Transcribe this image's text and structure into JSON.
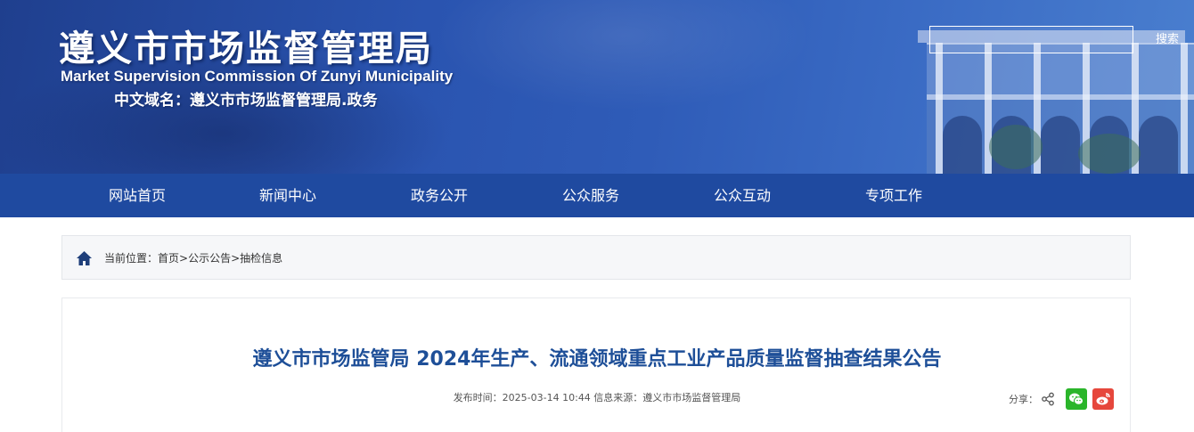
{
  "header": {
    "title": "遵义市市场监督管理局",
    "title_en": "Market Supervision Commission Of Zunyi Municipality",
    "domain_line": "中文域名：遵义市市场监督管理局.政务",
    "search_placeholder": "",
    "search_button": "搜索"
  },
  "nav": {
    "items": [
      {
        "label": "网站首页"
      },
      {
        "label": "新闻中心"
      },
      {
        "label": "政务公开"
      },
      {
        "label": "公众服务"
      },
      {
        "label": "公众互动"
      },
      {
        "label": "专项工作"
      }
    ]
  },
  "breadcrumb": {
    "prefix": "当前位置：",
    "items": [
      "首页",
      "公示公告",
      "抽检信息"
    ],
    "separator": ">"
  },
  "article": {
    "title": "遵义市市场监管局 2024年生产、流通领域重点工业产品质量监督抽查结果公告",
    "meta": "发布时间：2025-03-14 10:44 信息来源：遵义市市场监督管理局",
    "share_label": "分享："
  },
  "colors": {
    "nav_bg": "#1f4aa0",
    "title_color": "#1e4f98",
    "wechat": "#2ab52a",
    "weibo": "#e6473c"
  }
}
